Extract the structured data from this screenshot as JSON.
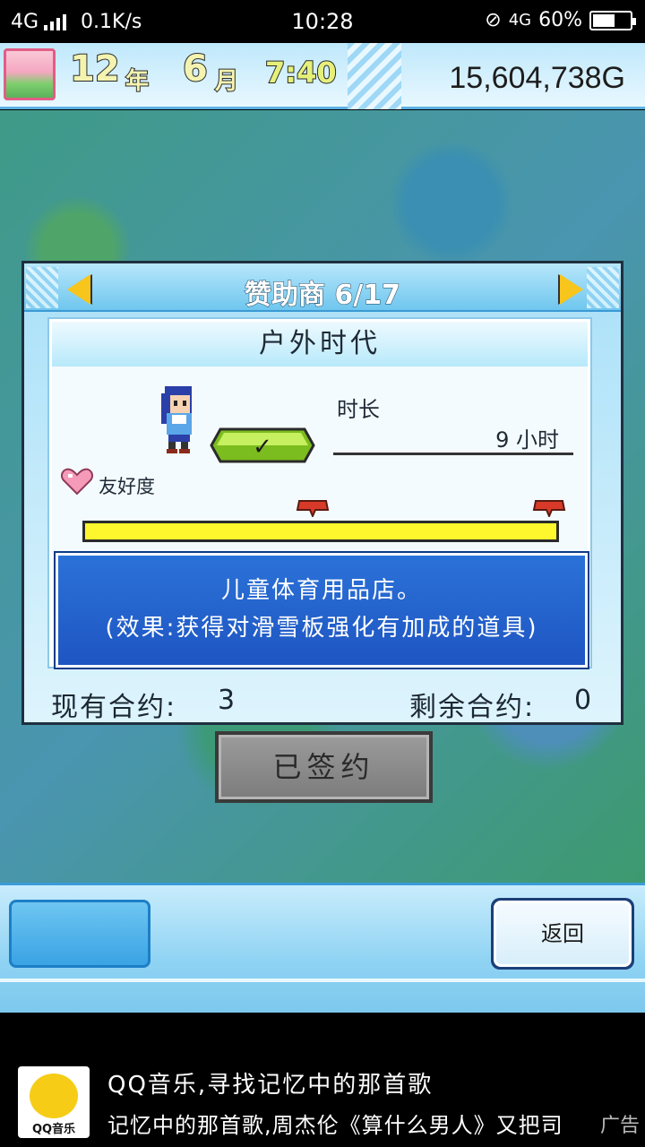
{
  "status_bar": {
    "network": "4G",
    "speed": "0.1K/s",
    "time": "10:28",
    "network_right": "4G",
    "battery_percent": "60%",
    "battery_level": 0.6
  },
  "game_header": {
    "year": "12",
    "year_label": "年",
    "month": "6",
    "month_label": "月",
    "clock": "7:40",
    "money": "15,604,738G"
  },
  "sponsor_panel": {
    "title": "赞助商 6/17",
    "sponsor_name": "户外时代",
    "duration_label": "时长",
    "duration_value": "9 小时",
    "friendship_label": "友好度",
    "check_mark": "✓",
    "description_line1": "儿童体育用品店。",
    "description_line2": "(效果:获得对滑雪板强化有加成的道具)",
    "current_contracts_label": "现有合约:",
    "current_contracts_value": "3",
    "remaining_contracts_label": "剩余合约:",
    "remaining_contracts_value": "0"
  },
  "signed_button": {
    "label": "已签约"
  },
  "bottom_bar": {
    "back_label": "返回"
  },
  "ad": {
    "logo_text": "QQ音乐",
    "line1": "QQ音乐,寻找记忆中的那首歌",
    "line2": "记忆中的那首歌,周杰伦《算什么男人》又把司",
    "tag": "广告"
  },
  "colors": {
    "accent_yellow": "#fff72e",
    "panel_blue": "#1e55c2",
    "check_green": "#a8e43a"
  }
}
